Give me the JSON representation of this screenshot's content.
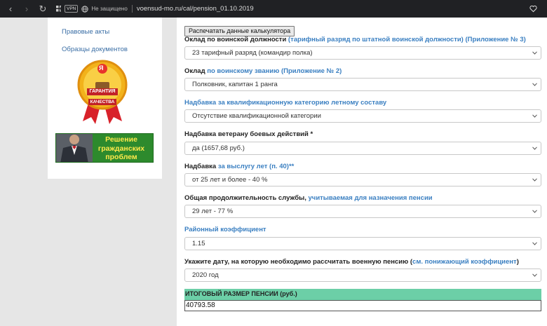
{
  "browser": {
    "vpn_badge": "VPN",
    "security_text": "Не защищено",
    "url": "voensud-mo.ru/cal/pension_01.10.2019"
  },
  "sidebar": {
    "links": [
      "Правовые акты",
      "Образцы документов"
    ],
    "badge": {
      "letter": "Я",
      "line1": "ГАРАНТИЯ",
      "line2": "КАЧЕСТВА"
    },
    "banner_lines": [
      "Решение",
      "гражданских",
      "проблем"
    ]
  },
  "calculator": {
    "print_button": "Распечатать данные калькулятора",
    "fields": [
      {
        "label": "Оклад по воинской должности ",
        "link": "(тарифный разряд по штатной воинской должности) (Приложение № 3)",
        "suffix": "",
        "value": "23 тарифный разряд (командир полка)"
      },
      {
        "label": "Оклад ",
        "link": "по воинскому званию (Приложение № 2)",
        "suffix": "",
        "value": "Полковник, капитан 1 ранга"
      },
      {
        "label": "",
        "link": "Надбавка за квалификационную категорию летному составу",
        "suffix": "",
        "value": "Отсутствие квалификационной категории"
      },
      {
        "label": "Надбавка ветерану боевых действий *",
        "link": "",
        "suffix": "",
        "value": "да (1657,68 руб.)"
      },
      {
        "label": "Надбавка ",
        "link": "за выслугу лет (п. 40)**",
        "suffix": "",
        "value": "от 25 лет и более - 40 %"
      },
      {
        "label": "Общая продолжительность службы, ",
        "link": "учитываемая для назначения пенсии",
        "suffix": "",
        "value": "29 лет - 77 %"
      },
      {
        "label": "",
        "link": "Районный коэффициент",
        "suffix": "",
        "value": "1.15"
      },
      {
        "label": "Укажите дату, на которую необходимо рассчитать военную пенсию (",
        "link": "см. понижающий коэффициент",
        "suffix": ")",
        "value": "2020 год"
      }
    ],
    "result_label": "ИТОГОВЫЙ РАЗМЕР ПЕНСИИ (руб.)",
    "result_value": "40793.58"
  },
  "colors": {
    "link": "#3a7fc1",
    "result_bar": "#6ccfa7",
    "banner": "#2d8a2d"
  }
}
